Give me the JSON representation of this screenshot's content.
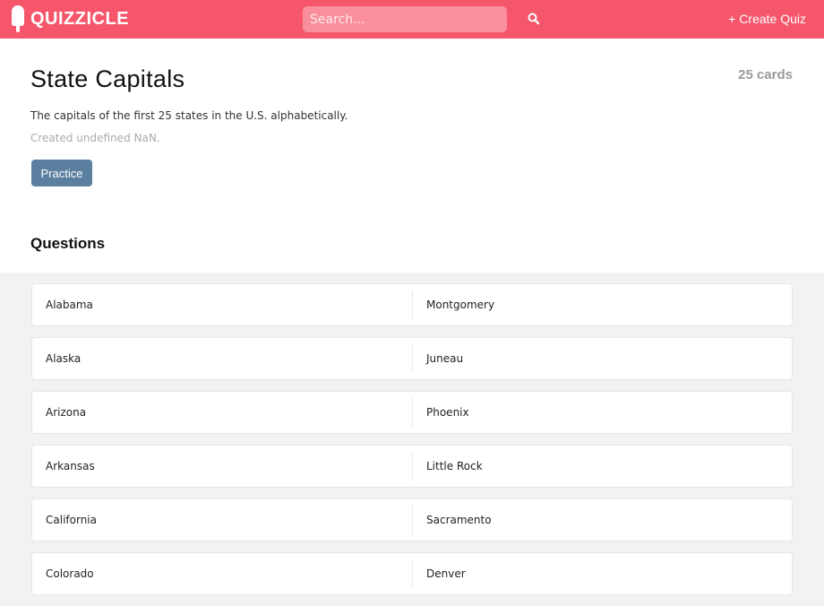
{
  "navbar": {
    "logo_text": "QUIZZICLE",
    "search_placeholder": "Search...",
    "create_quiz_label": "+ Create Quiz"
  },
  "quiz": {
    "title": "State Capitals",
    "card_count": "25 cards",
    "description": "The capitals of the first 25 states in the U.S. alphabetically.",
    "created": "Created undefined NaN.",
    "practice_label": "Practice"
  },
  "questions_heading": "Questions",
  "cards": [
    {
      "term": "Alabama",
      "definition": "Montgomery"
    },
    {
      "term": "Alaska",
      "definition": "Juneau"
    },
    {
      "term": "Arizona",
      "definition": "Phoenix"
    },
    {
      "term": "Arkansas",
      "definition": "Little Rock"
    },
    {
      "term": "California",
      "definition": "Sacramento"
    },
    {
      "term": "Colorado",
      "definition": "Denver"
    }
  ],
  "colors": {
    "brand": "#f5566b",
    "practice_button": "#5b7f9f"
  },
  "icons": {
    "logo": "popsicle-icon",
    "search": "search-icon"
  }
}
